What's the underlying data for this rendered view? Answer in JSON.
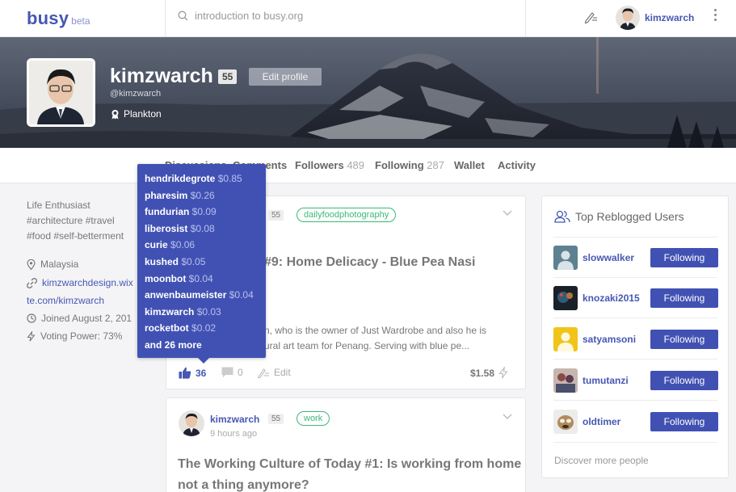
{
  "header": {
    "logo": "busy",
    "logo_suffix": "beta",
    "search_value": "introduction to busy.org",
    "username": "kimzwarch"
  },
  "profile": {
    "name": "kimzwarch",
    "reputation": "55",
    "edit_label": "Edit profile",
    "handle": "@kimzwarch",
    "rank": "Plankton"
  },
  "tabs": {
    "discussions": "Discussions",
    "comments": "Comments",
    "followers_label": "Followers",
    "followers_count": "489",
    "following_label": "Following",
    "following_count": "287",
    "wallet": "Wallet",
    "activity": "Activity"
  },
  "about": {
    "bio_line1": "Life Enthusiast",
    "bio_line2": "#architecture #travel",
    "bio_line3": "#food #self-betterment",
    "location": "Malaysia",
    "website_line1": "kimzwarchdesign.wix",
    "website_line2": "te.com/kimzwarch",
    "joined": "Joined August 2, 201",
    "voting_power": "Voting Power: 73%"
  },
  "tooltip": {
    "voters": [
      {
        "name": "hendrikdegrote",
        "amount": "$0.85"
      },
      {
        "name": "pharesim",
        "amount": "$0.26"
      },
      {
        "name": "fundurian",
        "amount": "$0.09"
      },
      {
        "name": "liberosist",
        "amount": "$0.08"
      },
      {
        "name": "curie",
        "amount": "$0.06"
      },
      {
        "name": "kushed",
        "amount": "$0.05"
      },
      {
        "name": "moonbot",
        "amount": "$0.04"
      },
      {
        "name": "anwenbaumeister",
        "amount": "$0.04"
      },
      {
        "name": "kimzwarch",
        "amount": "$0.03"
      },
      {
        "name": "rocketbot",
        "amount": "$0.02"
      }
    ],
    "more": "and 26 more"
  },
  "posts": [
    {
      "reputation": "55",
      "tag": "dailyfoodphotography",
      "title_visible": "#9: Home Delicacy - Blue Pea Nasi",
      "excerpt_line1": "n, who is the owner of Just Wardrobe and also he is",
      "excerpt_line2": "ural art team for Penang. Serving with blue pe...",
      "votes": "36",
      "comments": "0",
      "edit_label": "Edit",
      "payout": "$1.58"
    },
    {
      "author": "kimzwarch",
      "reputation": "55",
      "tag": "work",
      "time": "9 hours ago",
      "title_line1": "The Working Culture of Today #1: Is working from home",
      "title_line2": "not a thing anymore?"
    }
  ],
  "sidebar": {
    "title": "Top Reblogged Users",
    "follow_label": "Following",
    "users": [
      {
        "name": "slowwalker"
      },
      {
        "name": "knozaki2015"
      },
      {
        "name": "satyamsoni"
      },
      {
        "name": "tumutanzi"
      },
      {
        "name": "oldtimer"
      }
    ],
    "discover": "Discover more people"
  },
  "colors": {
    "brand": "#4757b2",
    "tooltip_bg": "#4151b3",
    "tag_green": "#3cb878"
  }
}
